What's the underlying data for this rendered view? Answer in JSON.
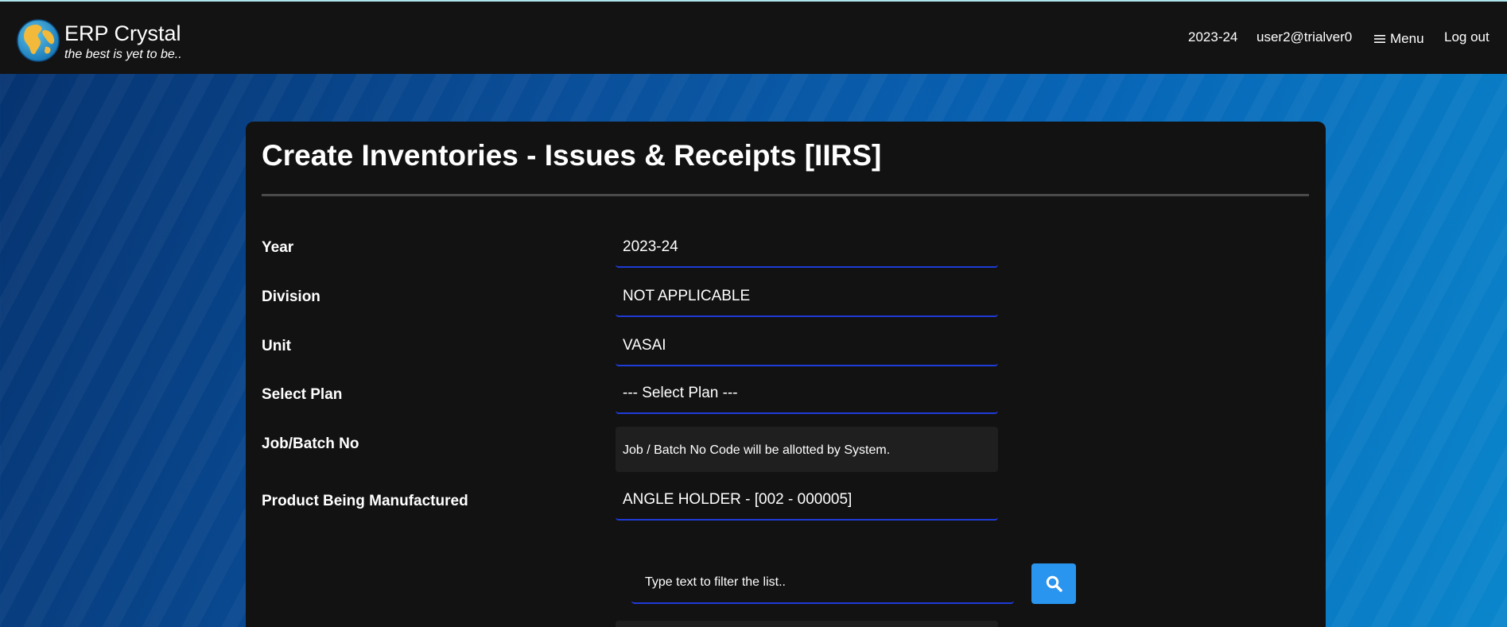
{
  "header": {
    "brand_title": "ERP Crystal",
    "brand_tagline": "the best is yet to be..",
    "logo_icon": "globe-icon",
    "year": "2023-24",
    "user": "user2@trialver0",
    "menu_icon": "hamburger-icon",
    "menu_label": "Menu",
    "logout_label": "Log out"
  },
  "form": {
    "title": "Create Inventories - Issues & Receipts [IIRS]",
    "year_label": "Year",
    "year_value": "2023-24",
    "division_label": "Division",
    "division_value": "NOT APPLICABLE",
    "unit_label": "Unit",
    "unit_value": "VASAI",
    "plan_label": "Select Plan",
    "plan_value": "--- Select Plan ---",
    "batch_label": "Job/Batch No",
    "batch_value": "Job / Batch No Code will be allotted by System.",
    "product_label": "Product Being Manufactured",
    "product_value": "ANGLE HOLDER - [002 - 000005]",
    "filter_placeholder": "Type text to filter the list..",
    "search_icon": "search-icon"
  },
  "colors": {
    "topbar_bg": "#131313",
    "card_bg": "#121212",
    "field_underline": "#1f3bd8",
    "search_button": "#2a95ee",
    "info_box_bg": "#1f1f1f"
  }
}
